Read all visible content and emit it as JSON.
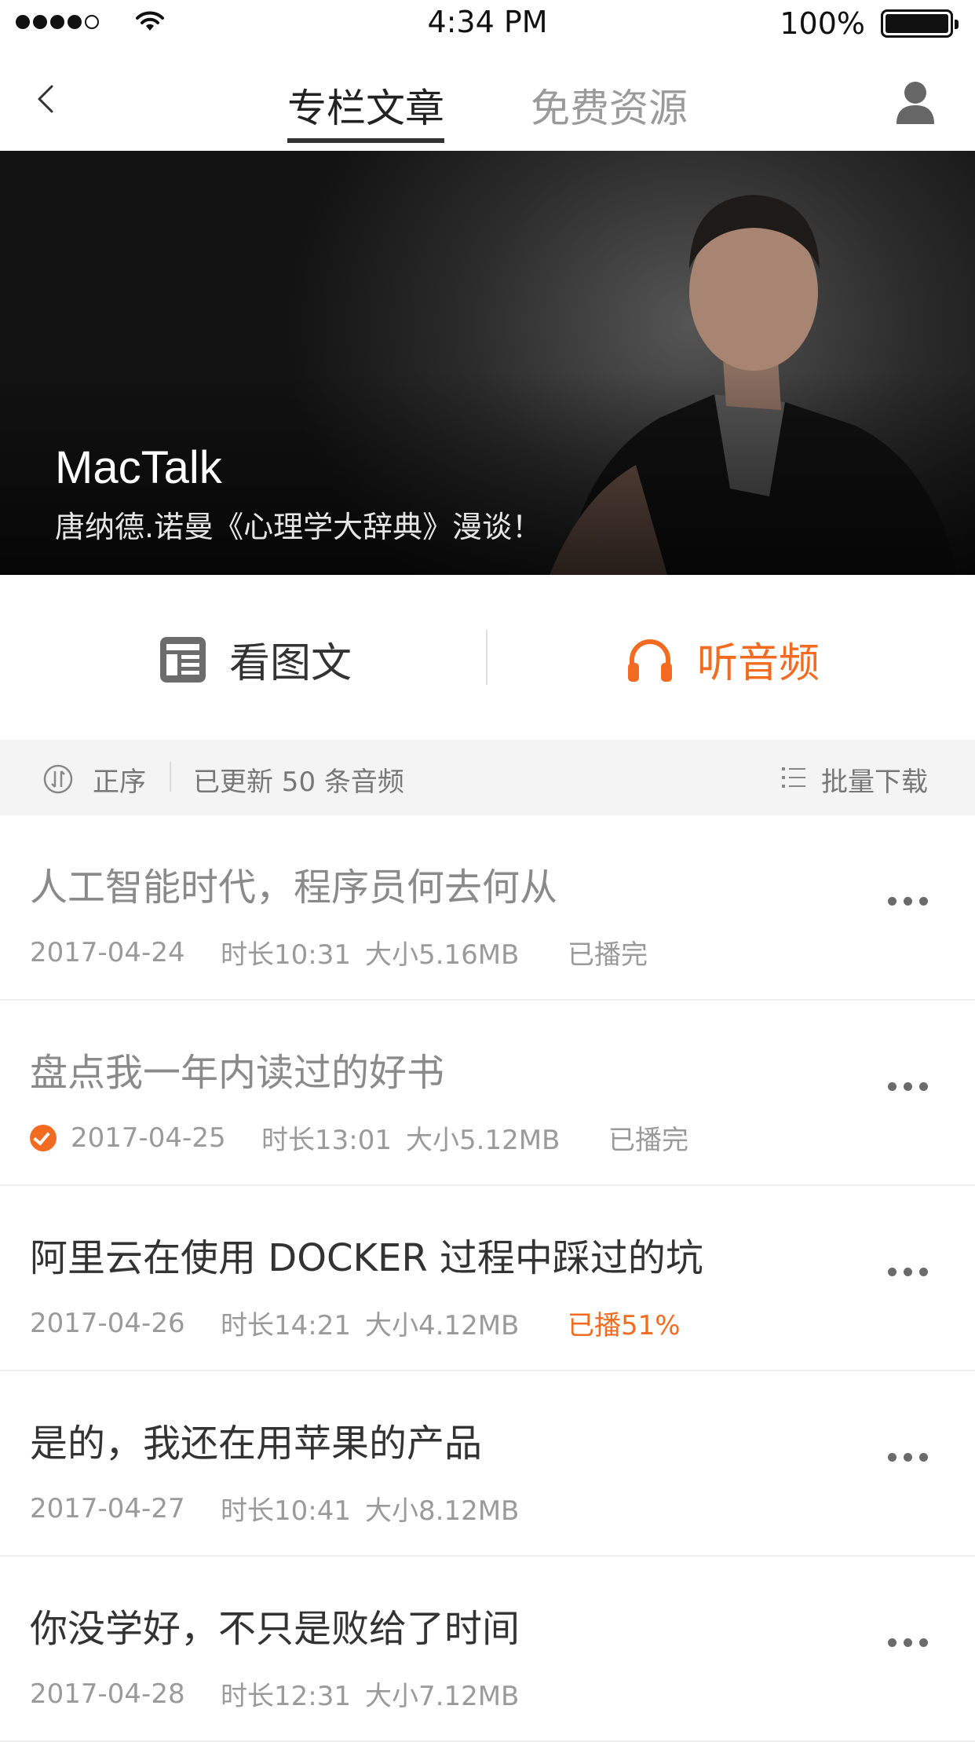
{
  "status_bar": {
    "time": "4:34 PM",
    "battery": "100%"
  },
  "nav": {
    "tabs": [
      "专栏文章",
      "免费资源"
    ],
    "active_tab": 0
  },
  "hero": {
    "title": "MacTalk",
    "subtitle": "唐纳德.诺曼《心理学大辞典》漫谈！"
  },
  "modes": {
    "read": "看图文",
    "listen": "听音频",
    "active": "listen"
  },
  "filter": {
    "sort": "正序",
    "count": "已更新 50 条音频",
    "batch": "批量下载"
  },
  "items": [
    {
      "title": "人工智能时代，程序员何去何从",
      "date": "2017-04-24",
      "duration": "时长10:31",
      "size": "大小5.16MB",
      "status": "已播完",
      "checked": false
    },
    {
      "title": "盘点我一年内读过的好书",
      "date": "2017-04-25",
      "duration": "时长13:01",
      "size": "大小5.12MB",
      "status": "已播完",
      "checked": true
    },
    {
      "title": "阿里云在使用 DOCKER 过程中踩过的坑",
      "date": "2017-04-26",
      "duration": "时长14:21",
      "size": "大小4.12MB",
      "status": "已播51%",
      "checked": false
    },
    {
      "title": "是的，我还在用苹果的产品",
      "date": "2017-04-27",
      "duration": "时长10:41",
      "size": "大小8.12MB",
      "status": "",
      "checked": false
    },
    {
      "title": "你没学好，不只是败给了时间",
      "date": "2017-04-28",
      "duration": "时长12:31",
      "size": "大小7.12MB",
      "status": "",
      "checked": false
    }
  ],
  "colors": {
    "accent": "#f26b21",
    "text_primary": "#333333",
    "text_secondary": "#9a9a9a",
    "filter_bg": "#f4f4f4"
  },
  "icons": [
    "back-chevron-icon",
    "user-icon",
    "article-icon",
    "headphones-icon",
    "sort-icon",
    "list-download-icon",
    "more-icon",
    "check-icon"
  ]
}
